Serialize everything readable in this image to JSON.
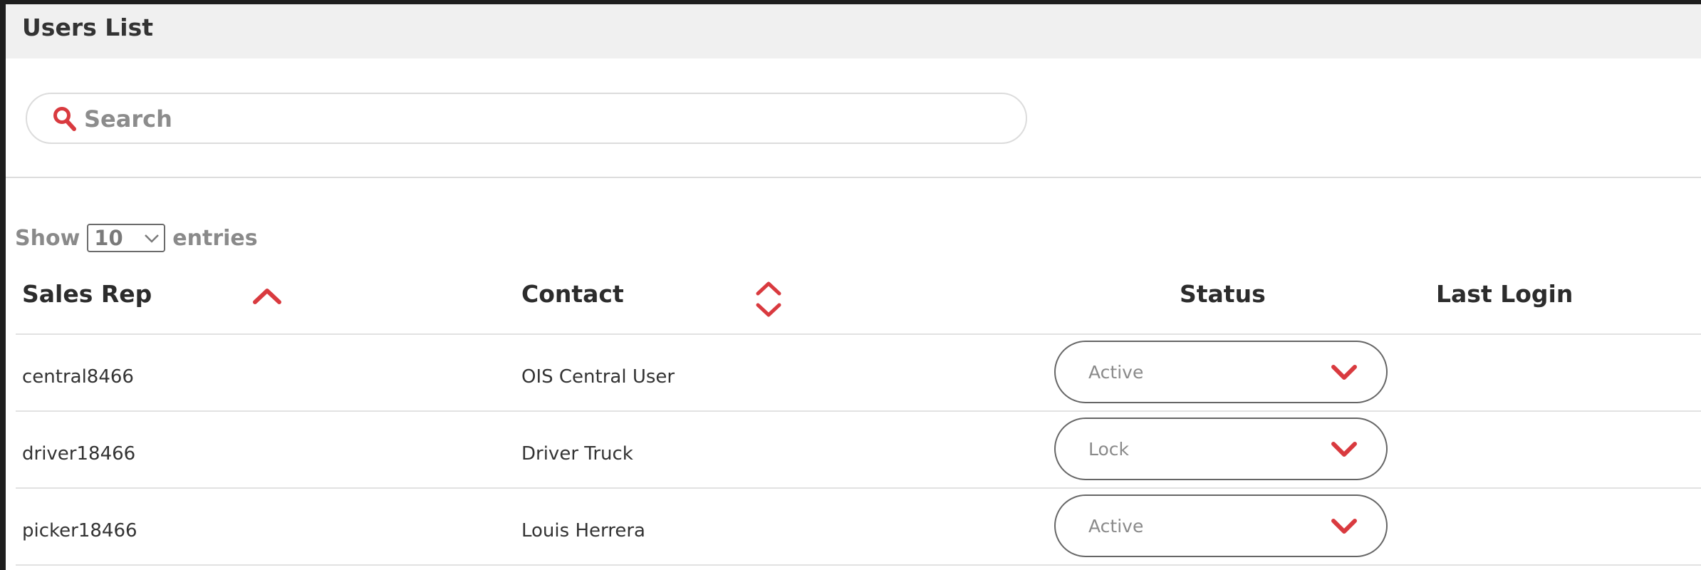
{
  "header": {
    "title": "Users List"
  },
  "search": {
    "placeholder": "Search",
    "value": ""
  },
  "entries": {
    "prefix": "Show",
    "selected": "10",
    "suffix": "entries"
  },
  "table": {
    "columns": [
      {
        "label": "Sales Rep"
      },
      {
        "label": "Contact"
      },
      {
        "label": "Status"
      },
      {
        "label": "Last Login"
      }
    ],
    "rows": [
      {
        "sales_rep": "central8466",
        "contact": "OIS Central User",
        "status": "Active",
        "last_login": ""
      },
      {
        "sales_rep": "driver18466",
        "contact": "Driver Truck",
        "status": "Lock",
        "last_login": ""
      },
      {
        "sales_rep": "picker18466",
        "contact": "Louis Herrera",
        "status": "Active",
        "last_login": ""
      }
    ]
  },
  "icons": {
    "search": "search-icon",
    "sort_asc": "sort-ascending-icon",
    "sort_both": "sort-icon",
    "dropdown": "chevron-down-icon"
  },
  "colors": {
    "accent": "#d93a3f",
    "title_bg": "#f0f0f0"
  }
}
